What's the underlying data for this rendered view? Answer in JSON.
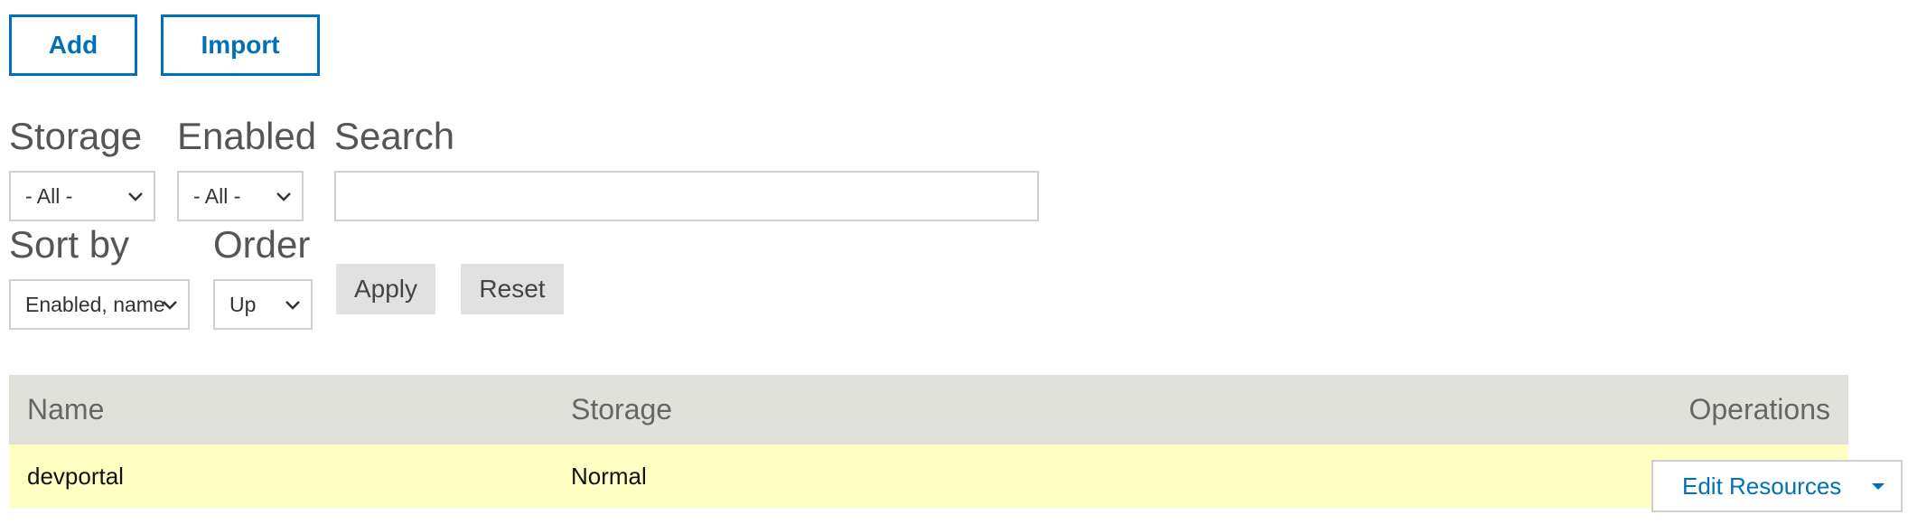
{
  "actions": {
    "add_label": "Add",
    "import_label": "Import"
  },
  "filters": {
    "storage": {
      "label": "Storage",
      "selected": "- All -"
    },
    "enabled": {
      "label": "Enabled",
      "selected": "- All -"
    },
    "search": {
      "label": "Search",
      "value": "",
      "placeholder": ""
    },
    "sort_by": {
      "label": "Sort by",
      "selected": "Enabled, name"
    },
    "order": {
      "label": "Order",
      "selected": "Up"
    },
    "apply_label": "Apply",
    "reset_label": "Reset"
  },
  "table": {
    "columns": [
      "Name",
      "Storage",
      "Operations"
    ],
    "rows": [
      {
        "name": "devportal",
        "storage": "Normal",
        "operation": "Edit Resources",
        "highlight": "#ffffc4"
      }
    ]
  },
  "icons": {
    "select_arrow": "chevron-down-icon",
    "dropbutton_arrow": "caret-down-icon"
  },
  "colors": {
    "accent": "#0071b8",
    "header_bg": "#e1e1dc",
    "button_grey": "#e1e1e1",
    "row_highlight": "#ffffc4"
  }
}
